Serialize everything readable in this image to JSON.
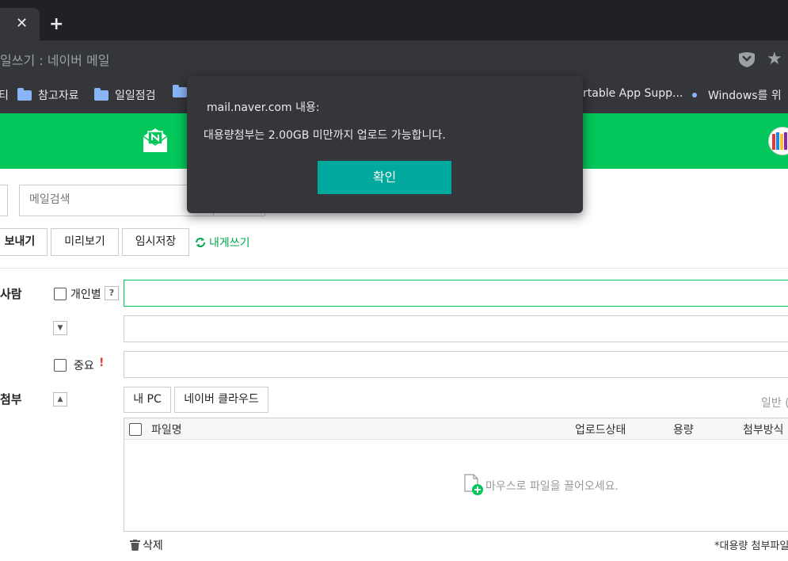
{
  "browser": {
    "tab_close_glyph": "✕",
    "new_tab_glyph": "+",
    "page_title": "일쓰기 : 네이버 메일",
    "bookmarks": [
      {
        "label": "티",
        "folder": false
      },
      {
        "label": "참고자료",
        "folder": true
      },
      {
        "label": "일일점검",
        "folder": true
      },
      {
        "label": "rtable App Supp...",
        "folder": false
      },
      {
        "label": "Windows를 위",
        "folder": false
      }
    ]
  },
  "search": {
    "placeholder": "메일검색"
  },
  "toolbar": {
    "send_label": "보내기",
    "preview_label": "미리보기",
    "draft_label": "임시저장",
    "self_write_label": "내게쓰기"
  },
  "compose": {
    "recipient_label": "사람",
    "individual_label": "개인별",
    "help_glyph": "?",
    "important_label": "중요",
    "important_mark": "!",
    "attach_label": "첨부"
  },
  "attach": {
    "my_pc_label": "내 PC",
    "cloud_label": "네이버 클라우드",
    "mode_label": "일반 (",
    "col_filename": "파일명",
    "col_status": "업로드상태",
    "col_size": "용량",
    "col_method": "첨부방식",
    "drop_hint": "마우스로 파일을 끌어오세요.",
    "delete_label": "삭제",
    "large_note": "*대용량 첨부파일"
  },
  "dialog": {
    "origin": "mail.naver.com 내용:",
    "message": "대용량첨부는 2.00GB 미만까지 업로드 가능합니다.",
    "confirm_label": "확인"
  },
  "colors": {
    "naver_green": "#03c75a",
    "dialog_bg": "#35363a",
    "confirm_bg": "#00a99d",
    "chrome_dark": "#202124"
  }
}
